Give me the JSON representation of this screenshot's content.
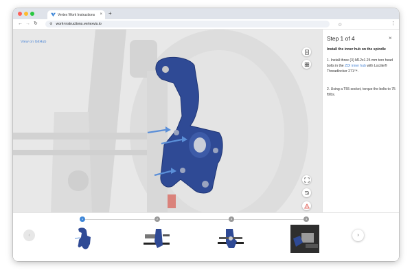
{
  "browser": {
    "tab_title": "Vertex Work Instructions",
    "tab_close": "×",
    "new_tab": "+",
    "url": "work-instructions.vertexvis.io",
    "back": "←",
    "forward": "→",
    "reload": "↻",
    "bookmark": "☆",
    "menu": "⋮",
    "traffic_lights": [
      "#ff5f57",
      "#febc2e",
      "#28c840"
    ]
  },
  "viewer": {
    "link_text": "View on GitHub",
    "tools": [
      "document-icon",
      "parts-icon",
      "fit-view-icon",
      "reset-view-icon",
      "warning-icon"
    ]
  },
  "panel": {
    "title": "Step 1 of 4",
    "close": "×",
    "heading": "Install the inner hub on the spindle",
    "instruction1_pre": "1. Install three (3) M12x1.25 mm torx head bolts in the ",
    "instruction1_link": "ZDI inner hub",
    "instruction1_post": " with Loctite® Threadlocker 271™.",
    "instruction2": "2. Using a T55 socket, torque the bolts to 75 ft/lbs."
  },
  "steps": {
    "current": 1,
    "items": [
      {
        "label": "1",
        "active": true
      },
      {
        "label": "2",
        "active": false
      },
      {
        "label": "3",
        "active": false
      },
      {
        "label": "4",
        "active": false
      }
    ],
    "prev": "‹",
    "next": "›"
  },
  "colors": {
    "accent": "#3f87d8",
    "part_blue": "#2f4a95",
    "arrow_blue": "#5b8fd8",
    "warning_red": "#d9463b"
  }
}
